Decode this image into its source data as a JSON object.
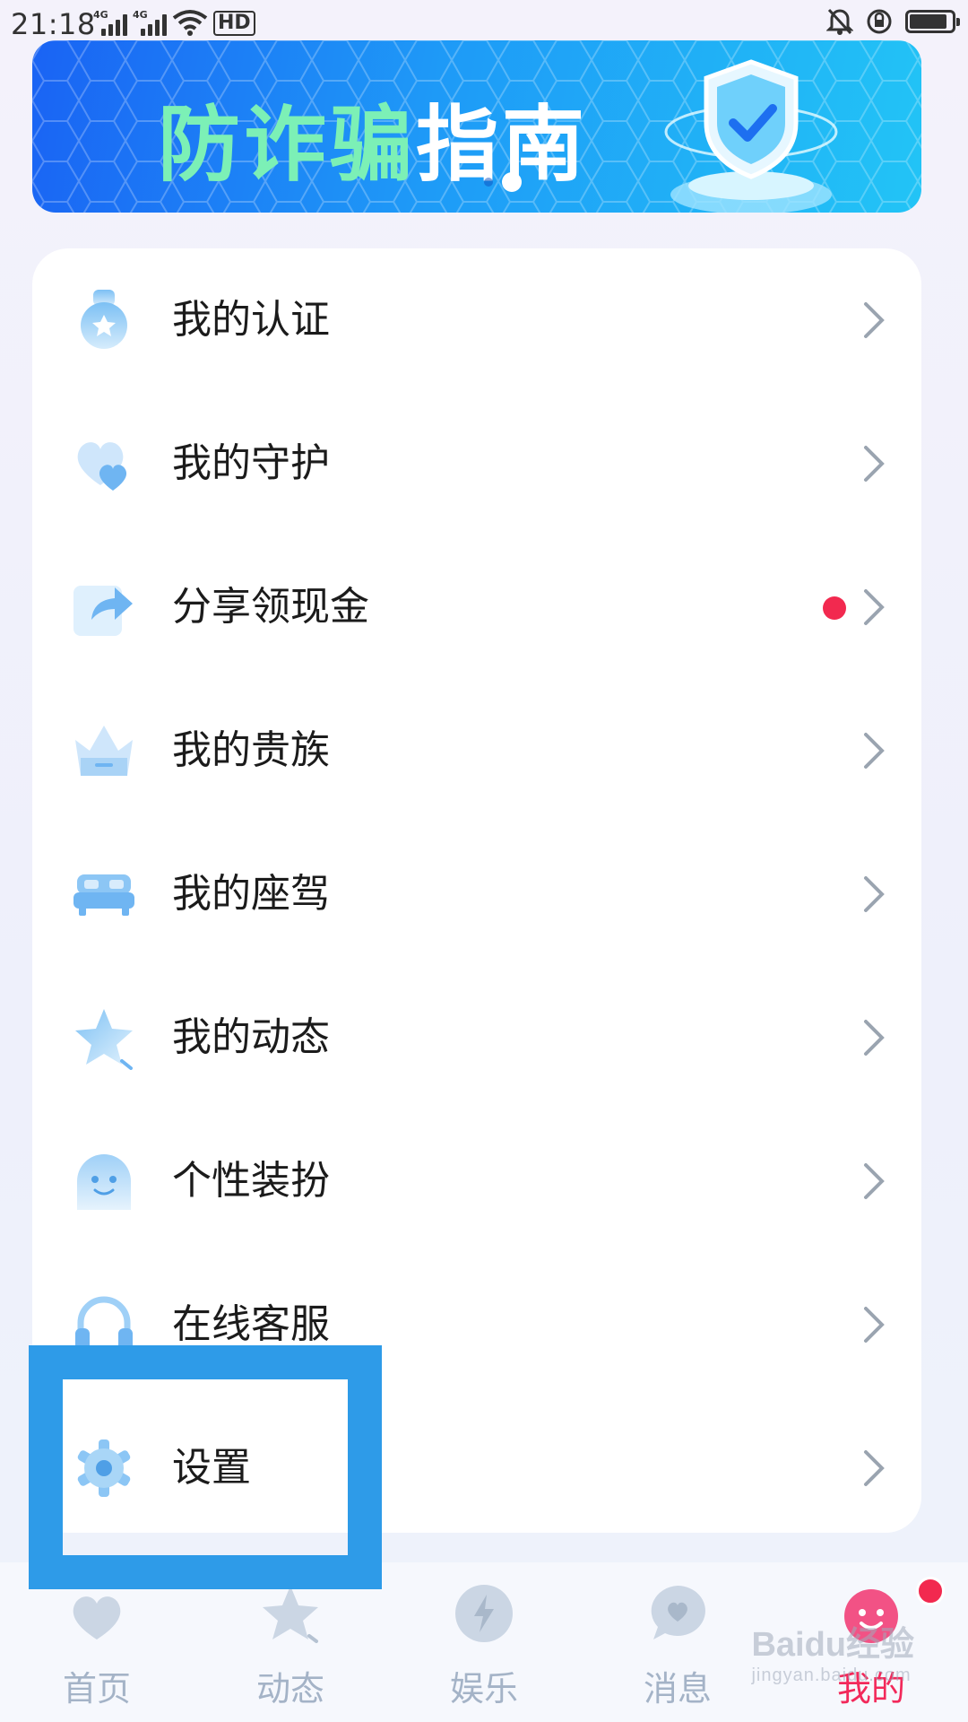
{
  "status_bar": {
    "time": "21:18",
    "network_1": "4G",
    "network_2": "4G",
    "hd_label": "HD",
    "battery_level": 0.9
  },
  "banner": {
    "title_part1": "防诈骗",
    "title_part2": "指南",
    "carousel_count": 2,
    "carousel_active": 1
  },
  "menu": {
    "items": [
      {
        "label": "我的认证",
        "icon": "certification-badge-icon",
        "has_dot": false
      },
      {
        "label": "我的守护",
        "icon": "hearts-icon",
        "has_dot": false
      },
      {
        "label": "分享领现金",
        "icon": "share-arrow-icon",
        "has_dot": true
      },
      {
        "label": "我的贵族",
        "icon": "crown-icon",
        "has_dot": false
      },
      {
        "label": "我的座驾",
        "icon": "car-icon",
        "has_dot": false
      },
      {
        "label": "我的动态",
        "icon": "star-icon",
        "has_dot": false
      },
      {
        "label": "个性装扮",
        "icon": "ghost-face-icon",
        "has_dot": false
      },
      {
        "label": "在线客服",
        "icon": "headset-icon",
        "has_dot": false
      },
      {
        "label": "设置",
        "icon": "gear-icon",
        "has_dot": false
      }
    ]
  },
  "bottom_nav": {
    "items": [
      {
        "label": "首页",
        "icon": "home-heart-icon"
      },
      {
        "label": "动态",
        "icon": "star-icon"
      },
      {
        "label": "娱乐",
        "icon": "lightning-icon"
      },
      {
        "label": "消息",
        "icon": "message-heart-icon"
      },
      {
        "label": "我的",
        "icon": "profile-face-icon"
      }
    ],
    "active_index": 4
  },
  "watermark": {
    "line1": "Baidu经验",
    "line2": "jingyan.baidu.com"
  },
  "colors": {
    "accent_pink": "#f2295a",
    "badge_red": "#f2294f",
    "highlight_blue": "#2e9be8",
    "icon_blue": "#7cc0f4"
  }
}
